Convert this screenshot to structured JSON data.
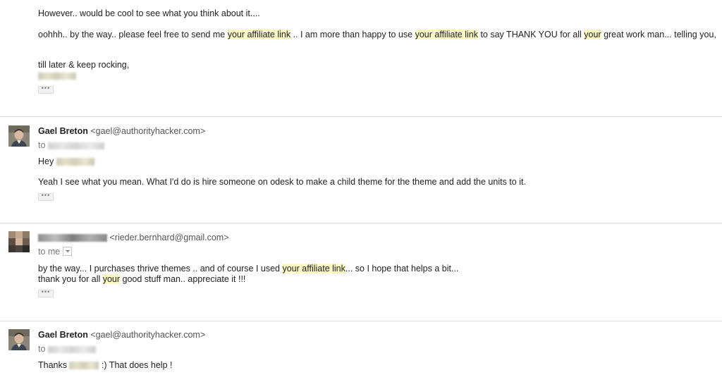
{
  "message1": {
    "line1": "However.. would be cool to see what you think about it....",
    "line2": {
      "p1": "oohhh.. by the way.. please feel free to send me ",
      "h1": "your affiliate link",
      "p2": " .. I am more than happy to use ",
      "h2": "your affiliate link",
      "p3": " to say THANK YOU for all ",
      "h3": "your",
      "p4": " great work man... telling you,"
    },
    "signoff": "till later & keep rocking,",
    "dots": "•••"
  },
  "message2": {
    "sender_name": "Gael Breton",
    "sender_email": "<gael@authorityhacker.com>",
    "to_label": "to",
    "greeting": "Hey",
    "body": "Yeah I see what you mean. What I'd do is hire someone on odesk to make a child theme for the theme and add the units to it.",
    "dots": "•••"
  },
  "message3": {
    "sender_email": "<rieder.bernhard@gmail.com>",
    "to_label": "to me",
    "line1": {
      "p1": "by the way... I purchases thrive themes .. and of course I used ",
      "h1": "your affiliate link",
      "p2": "... so I hope that helps a bit..."
    },
    "line2": {
      "p1": "thank you for all ",
      "h1": "your",
      "p2": " good stuff man.. appreciate it !!!"
    },
    "dots": "•••"
  },
  "message4": {
    "sender_name": "Gael Breton",
    "sender_email": "<gael@authorityhacker.com>",
    "to_label": "to",
    "thanks_prefix": "Thanks",
    "thanks_suffix": " :) That does help !"
  },
  "colors": {
    "highlight": "#fcf8c4",
    "separator": "#dcdcdc"
  },
  "icons": [
    "avatar-gael",
    "avatar-blurred",
    "ellipsis-icon",
    "chevron-down-icon"
  ]
}
